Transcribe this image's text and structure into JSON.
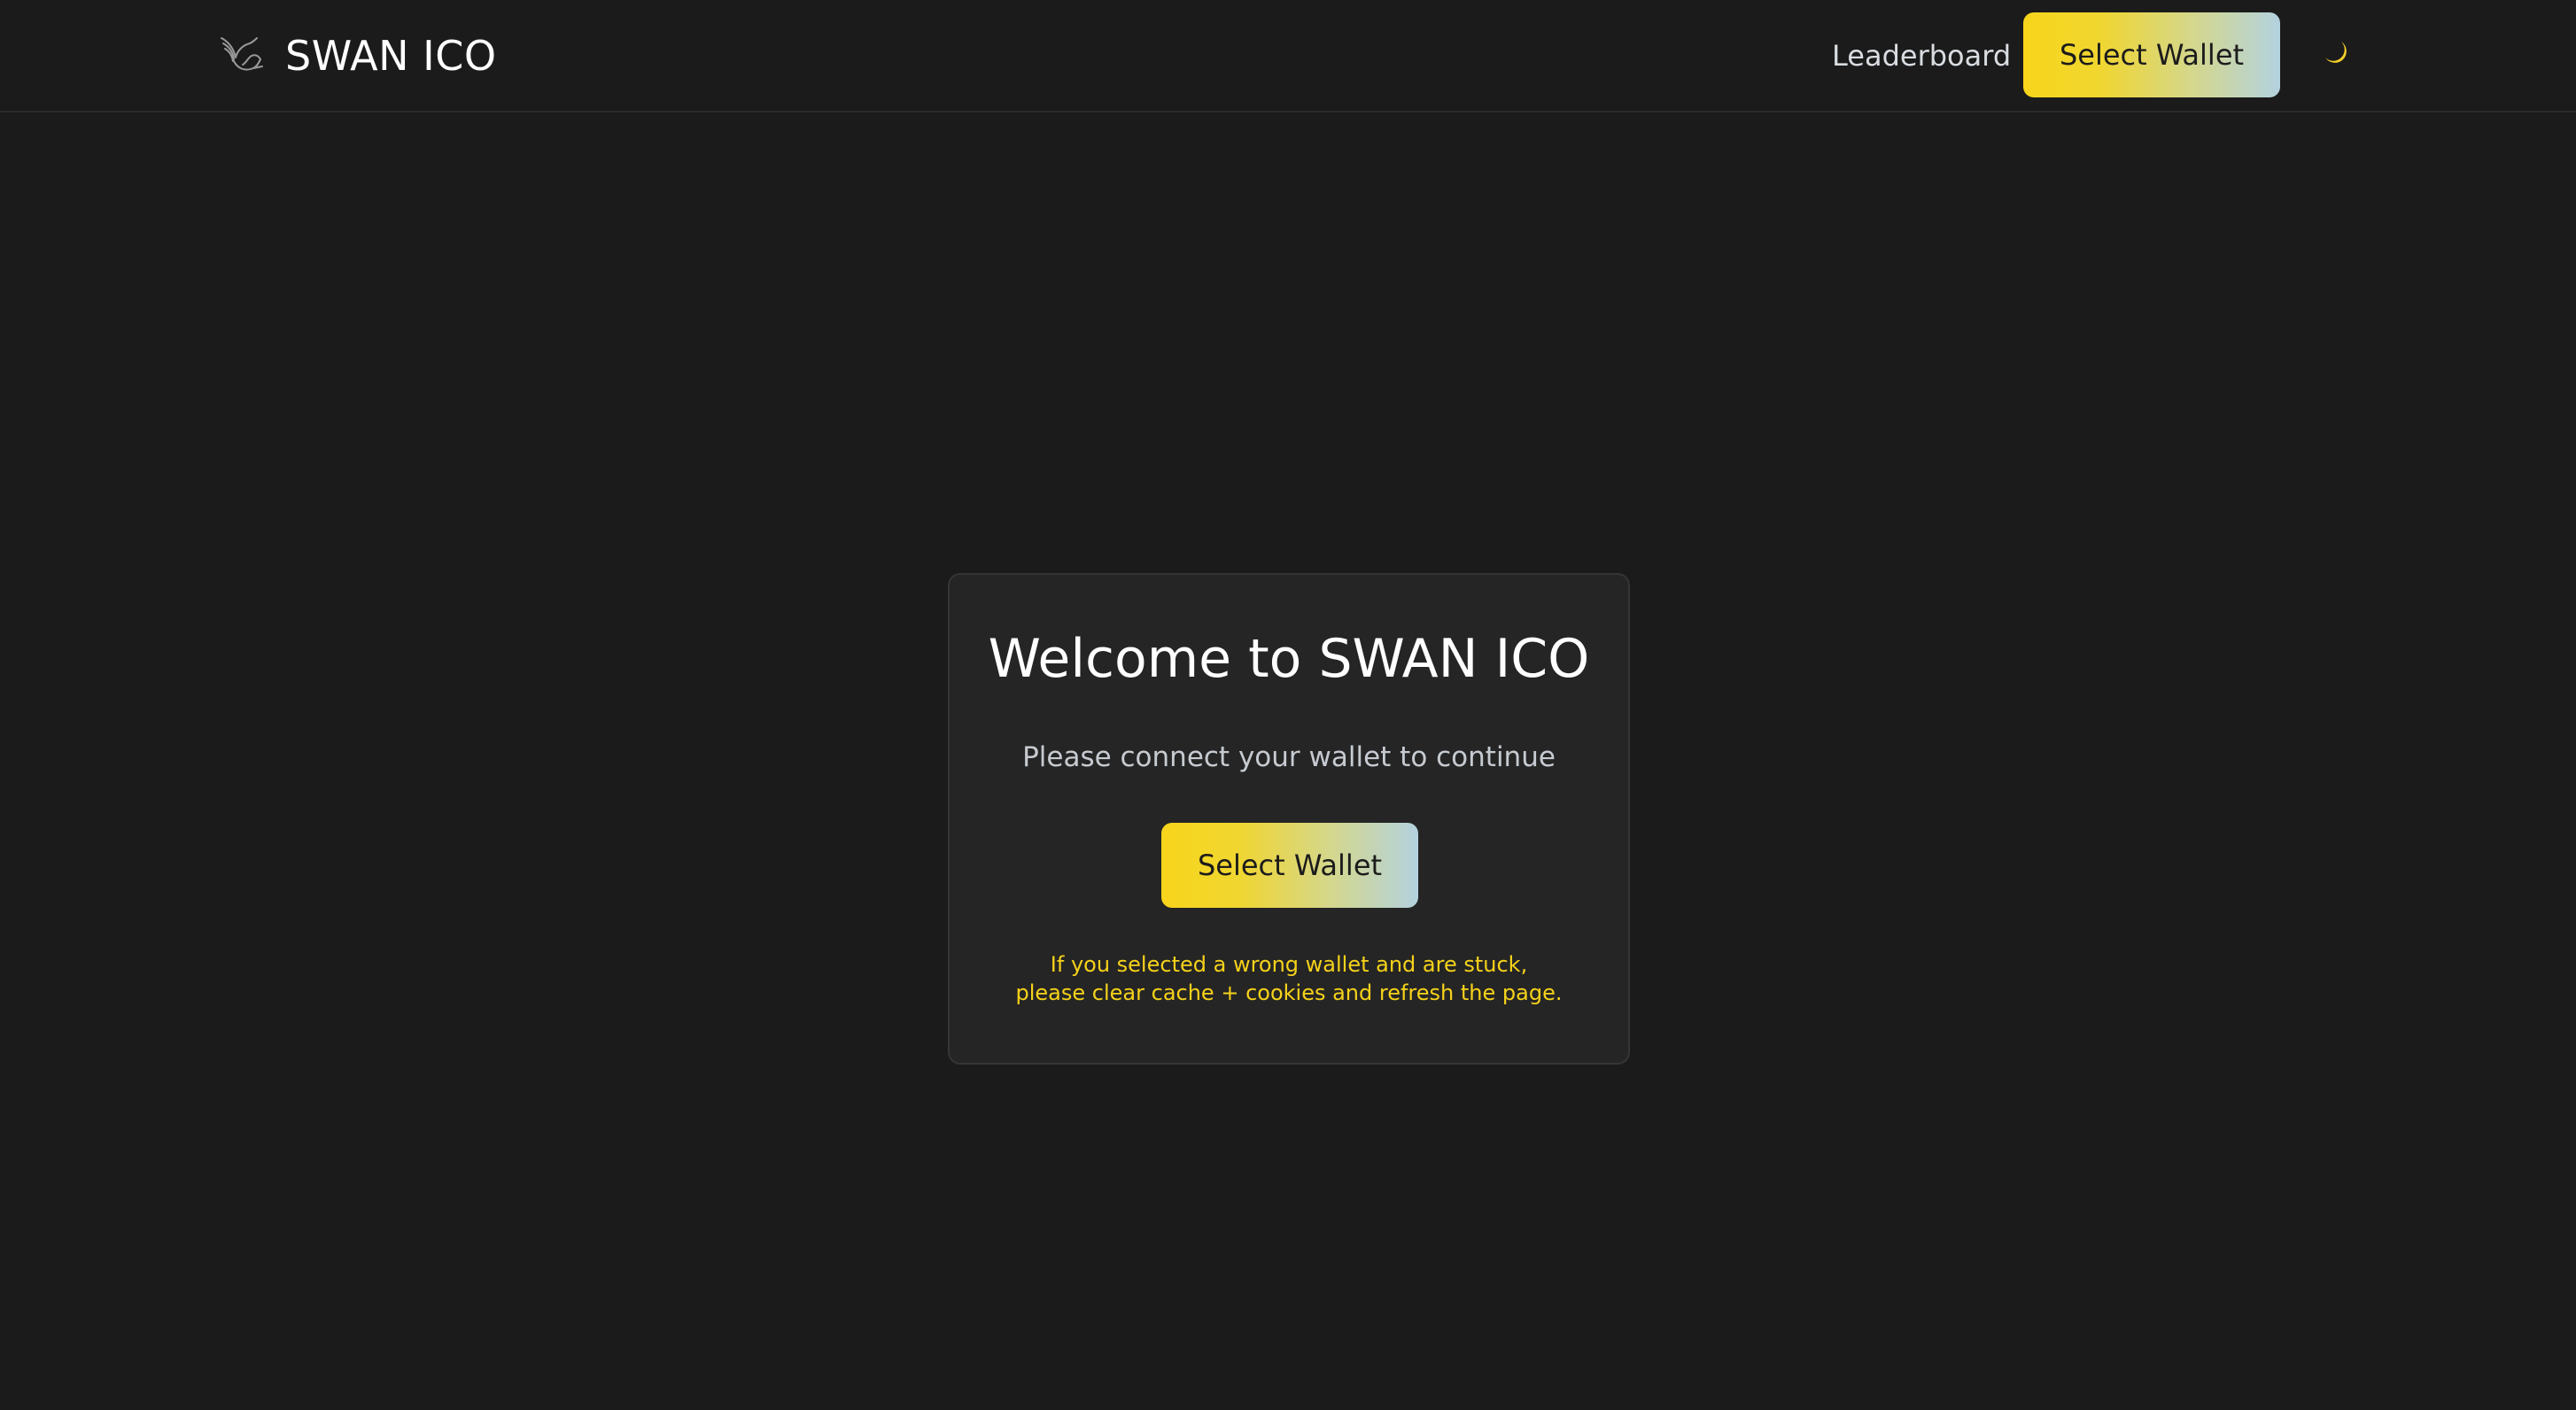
{
  "header": {
    "brand_name": "SWAN ICO",
    "brand_icon": "swan-icon",
    "nav_leaderboard": "Leaderboard",
    "select_wallet_label": "Select Wallet",
    "theme_toggle_icon": "moon-icon"
  },
  "card": {
    "title": "Welcome to SWAN ICO",
    "subtitle": "Please connect your wallet to continue",
    "select_wallet_label": "Select Wallet",
    "warning_line1": "If you selected a wrong wallet and are stuck,",
    "warning_line2": "please clear cache + cookies and refresh the page."
  },
  "colors": {
    "background": "#1b1b1b",
    "card_background": "#252525",
    "accent_yellow": "#f8d51b",
    "accent_blue": "#b3d2df",
    "warning_text": "#f6d21a"
  }
}
